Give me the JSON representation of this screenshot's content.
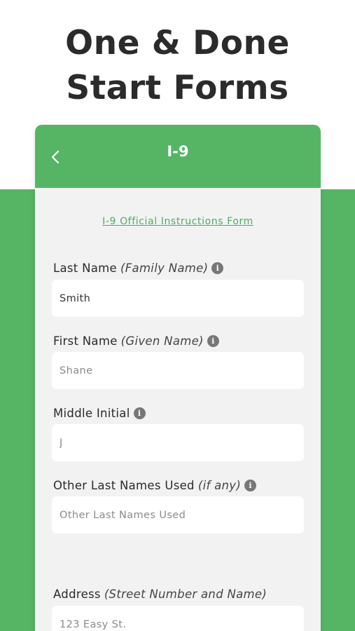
{
  "headline": {
    "line1": "One & Done",
    "line2": "Start Forms"
  },
  "app_bar": {
    "back_icon": "chevron-left-icon",
    "title": "I-9"
  },
  "instructions_link": "I-9 Official Instructions Form",
  "fields": [
    {
      "label": "Last Name",
      "hint": "(Family Name)",
      "info": "i",
      "value": "Smith",
      "placeholder": ""
    },
    {
      "label": "First Name",
      "hint": "(Given Name)",
      "info": "i",
      "value": "",
      "placeholder": "Shane"
    },
    {
      "label": "Middle Initial",
      "hint": "",
      "info": "i",
      "value": "",
      "placeholder": "J"
    },
    {
      "label": "Other Last Names Used",
      "hint": "(if any)",
      "info": "i",
      "value": "",
      "placeholder": "Other Last Names Used"
    },
    {
      "label": "Address",
      "hint": "(Street Number and Name)",
      "value": "",
      "placeholder": "123 Easy St."
    }
  ],
  "colors": {
    "brand_green": "#55b565",
    "link_green": "#4caf5c",
    "panel_bg": "#f2f2f2"
  }
}
